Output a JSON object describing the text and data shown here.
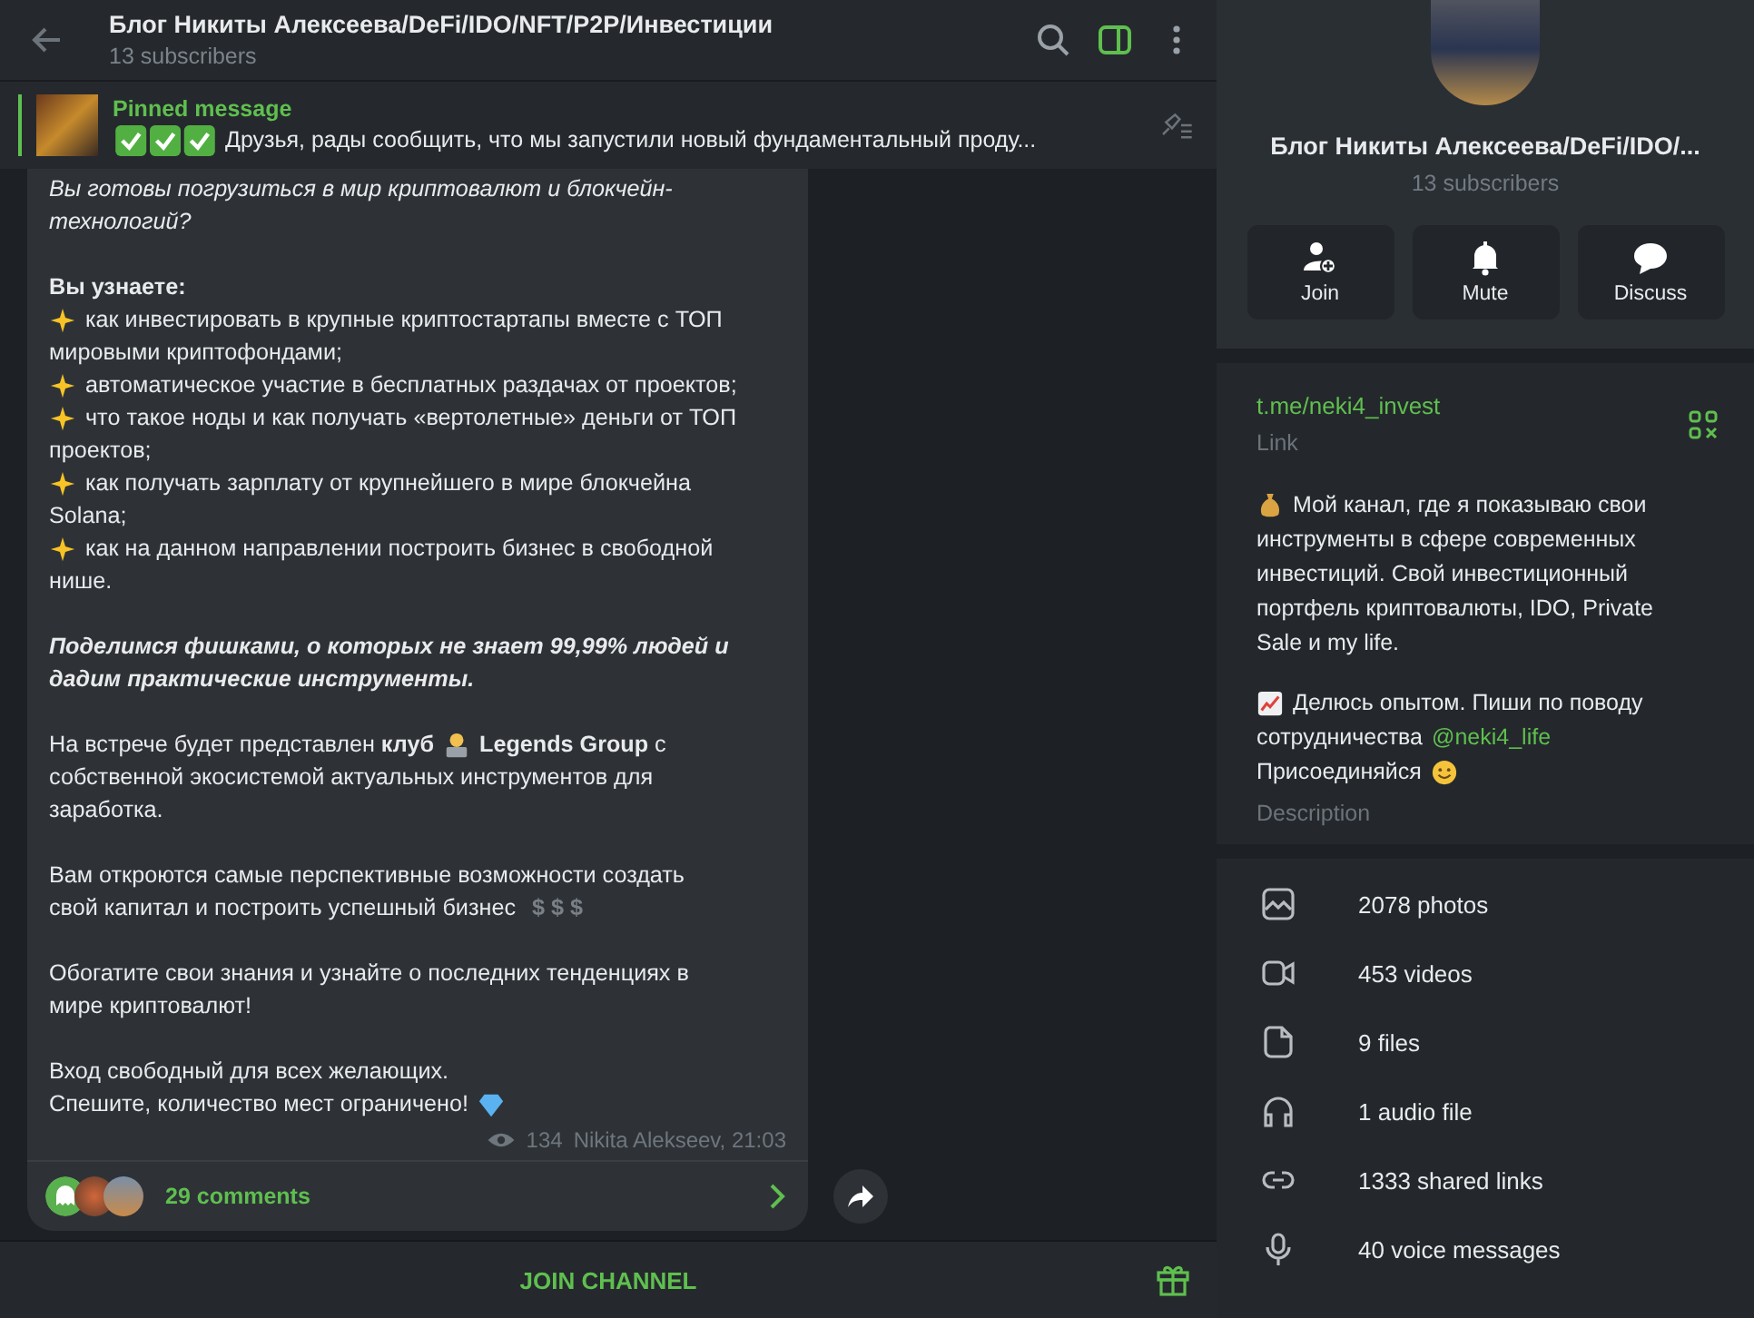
{
  "header": {
    "title": "Блог Никиты Алексеева/DeFi/IDO/NFT/P2P/Инвестиции",
    "subtitle": "13 subscribers",
    "side_panel_open": true
  },
  "pinned": {
    "label": "Pinned message",
    "text": "Друзья, рады сообщить, что мы запустили новый фундаментальный проду..."
  },
  "message": {
    "paragraphs": [
      {
        "kind": "italic",
        "lines": [
          [
            {
              "kind": "text",
              "text": "Вы готовы погрузиться в мир криптовалют и блокчейн-"
            }
          ],
          [
            {
              "kind": "text",
              "text": "технологий?"
            }
          ]
        ]
      },
      {
        "kind": "plain",
        "lines": [
          [
            {
              "kind": "text",
              "text": "**Вы узнаете:**"
            }
          ],
          [
            {
              "kind": "sparkle"
            },
            {
              "kind": "text",
              "text": "как инвестировать в крупные криптостартапы вместе с ТОП"
            }
          ],
          [
            {
              "kind": "text",
              "text": "мировыми криптофондами;"
            }
          ],
          [
            {
              "kind": "sparkle"
            },
            {
              "kind": "text",
              "text": "автоматическое участие в бесплатных раздачах от проектов;"
            }
          ],
          [
            {
              "kind": "sparkle"
            },
            {
              "kind": "text",
              "text": "что такое ноды и как получать «вертолетные» деньги от ТОП"
            }
          ],
          [
            {
              "kind": "text",
              "text": "проектов;"
            }
          ],
          [
            {
              "kind": "sparkle"
            },
            {
              "kind": "text",
              "text": "как получать зарплату от крупнейшего в мире блокчейна"
            }
          ],
          [
            {
              "kind": "text",
              "text": "Solana;"
            }
          ],
          [
            {
              "kind": "sparkle"
            },
            {
              "kind": "text",
              "text": "как на данном направлении построить бизнес в свободной"
            }
          ],
          [
            {
              "kind": "text",
              "text": "нише."
            }
          ]
        ]
      },
      {
        "kind": "bold_italic",
        "lines": [
          [
            {
              "kind": "text",
              "text": "Поделимся фишками, о которых не знает 99,99% людей и"
            }
          ],
          [
            {
              "kind": "text",
              "text": "дадим практические инструменты."
            }
          ]
        ]
      },
      {
        "kind": "plain",
        "lines": [
          [
            {
              "kind": "text",
              "text": "На встрече будет представлен **клуб**"
            },
            {
              "kind": "person"
            },
            {
              "kind": "text",
              "text": "**Legends Group** с"
            }
          ],
          [
            {
              "kind": "text",
              "text": "собственной экосистемой актуальных инструментов для"
            }
          ],
          [
            {
              "kind": "text",
              "text": "заработка."
            }
          ]
        ]
      },
      {
        "kind": "plain",
        "lines": [
          [
            {
              "kind": "text",
              "text": "Вам откроются самые перспективные возможности создать"
            }
          ],
          [
            {
              "kind": "text",
              "text": "свой капитал и построить успешный бизнес"
            },
            {
              "kind": "muted",
              "text": "$ $ $"
            }
          ]
        ]
      },
      {
        "kind": "plain",
        "lines": [
          [
            {
              "kind": "text",
              "text": "Обогатите свои знания и узнайте о последних тенденциях в"
            }
          ],
          [
            {
              "kind": "text",
              "text": "мире криптовалют!"
            }
          ]
        ]
      },
      {
        "kind": "plain",
        "lines": [
          [
            {
              "kind": "text",
              "text": "Вход свободный для всех желающих."
            }
          ],
          [
            {
              "kind": "text",
              "text": "Спешите, количество мест ограничено!"
            },
            {
              "kind": "diamond"
            }
          ]
        ]
      }
    ],
    "views": "134",
    "author_time": "Nikita Alekseev, 21:03",
    "comments": "29 comments"
  },
  "join_button": "JOIN CHANNEL",
  "profile": {
    "name": "Блог Никиты Алексеева/DeFi/IDO/...",
    "subtitle": "13 subscribers",
    "actions": [
      {
        "kind": "join",
        "label": "Join"
      },
      {
        "kind": "bell",
        "label": "Mute"
      },
      {
        "kind": "chat",
        "label": "Discuss"
      }
    ],
    "link": "t.me/neki4_invest",
    "link_caption": "Link",
    "description": [
      {
        "lines": [
          [
            {
              "kind": "moneybag"
            },
            {
              "kind": "text",
              "text": "Мой канал, где я показываю свои"
            }
          ],
          [
            {
              "kind": "text",
              "text": "инструменты в сфере современных"
            }
          ],
          [
            {
              "kind": "text",
              "text": "инвестиций. Свой инвестиционный"
            }
          ],
          [
            {
              "kind": "text",
              "text": "портфель криптовалюты, IDO, Private"
            }
          ],
          [
            {
              "kind": "text",
              "text": "Sale и my life."
            }
          ]
        ]
      },
      {
        "lines": [
          [
            {
              "kind": "chart"
            },
            {
              "kind": "text",
              "text": "Делюсь опытом. Пиши по поводу"
            }
          ],
          [
            {
              "kind": "text",
              "text": "сотрудничества"
            },
            {
              "kind": "link",
              "text": "@neki4_life"
            }
          ],
          [
            {
              "kind": "text",
              "text": "Присоединяйся"
            },
            {
              "kind": "smile"
            }
          ]
        ]
      }
    ],
    "description_caption": "Description",
    "media": [
      {
        "kind": "photo",
        "label": "2078 photos"
      },
      {
        "kind": "video",
        "label": "453 videos"
      },
      {
        "kind": "file",
        "label": "9 files"
      },
      {
        "kind": "audio",
        "label": "1 audio file"
      },
      {
        "kind": "link",
        "label": "1333 shared links"
      },
      {
        "kind": "mic",
        "label": "40 voice messages"
      }
    ]
  }
}
